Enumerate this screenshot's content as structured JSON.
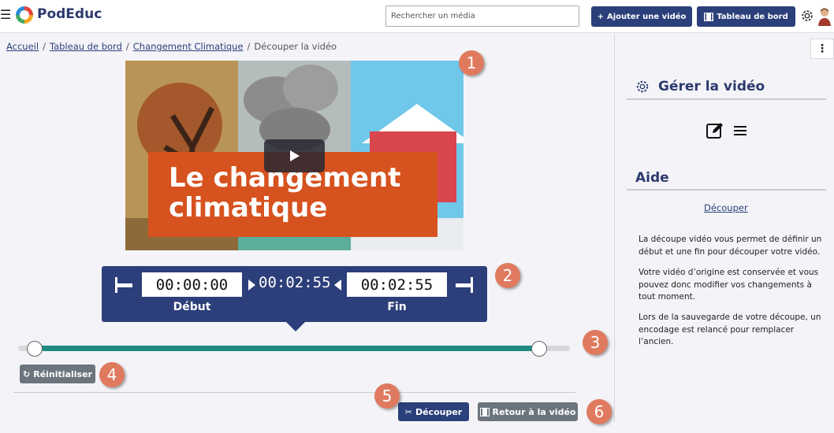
{
  "app": {
    "logo_text": "PodEduc"
  },
  "header": {
    "search_placeholder": "Rechercher un média",
    "add_video_label": "Ajouter une vidéo",
    "dashboard_label": "Tableau de bord"
  },
  "breadcrumb": {
    "items": [
      "Accueil",
      "Tableau de bord",
      "Changement Climatique"
    ],
    "current": "Découper la vidéo",
    "separator": "/"
  },
  "video": {
    "title_line1": "Le changement",
    "title_line2": "climatique"
  },
  "trim": {
    "start_value": "00:00:00",
    "start_label": "Début",
    "duration": "00:02:55",
    "end_value": "00:02:55",
    "end_label": "Fin"
  },
  "slider": {
    "start_fraction": 0.0,
    "end_fraction": 1.0
  },
  "actions": {
    "reset_label": "Réinitialiser",
    "cut_label": "Découper",
    "back_label": "Retour à la vidéo"
  },
  "callouts": [
    "1",
    "2",
    "3",
    "4",
    "5",
    "6"
  ],
  "right_panel": {
    "manage_title": "Gérer la vidéo",
    "help_title": "Aide",
    "help_link": "Découper",
    "help_paragraphs": [
      "La découpe vidéo vous permet de définir un début et une fin pour découper votre vidéo.",
      "Votre vidéo d’origine est conservée et vous pouvez donc modifier vos changements à tout moment.",
      "Lors de la sauvegarde de votre découpe, un encodage est relancé pour remplacer l’ancien."
    ]
  },
  "colors": {
    "brand": "#2b3f7a",
    "accent_track": "#1f8a80",
    "callout": "#e07a5f",
    "secondary": "#6c757d"
  }
}
